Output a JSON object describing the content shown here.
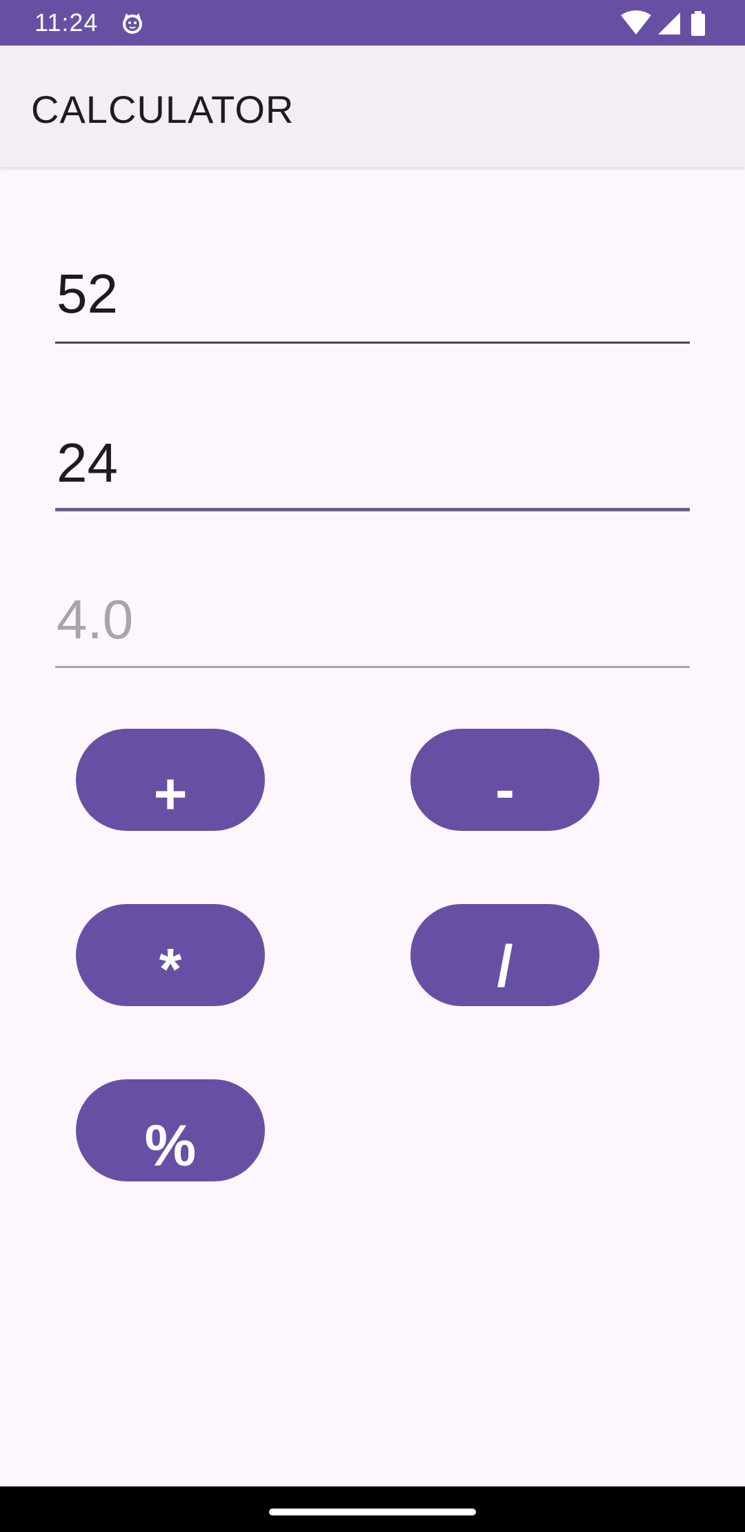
{
  "status_bar": {
    "time": "11:24",
    "icons": [
      "cat-notification-icon",
      "wifi-icon",
      "signal-icon",
      "battery-icon"
    ],
    "background_color": "#6750A4"
  },
  "app_bar": {
    "title": "CALCULATOR",
    "background_color": "#F3EEF6"
  },
  "inputs": {
    "first_number": "52",
    "second_number": "24"
  },
  "result": {
    "value": "4.0"
  },
  "operations": {
    "add": "+",
    "subtract": "-",
    "multiply": "*",
    "divide": "/",
    "modulo": "%"
  },
  "colors": {
    "accent": "#6750A4",
    "page_background": "#FDF7FD"
  }
}
